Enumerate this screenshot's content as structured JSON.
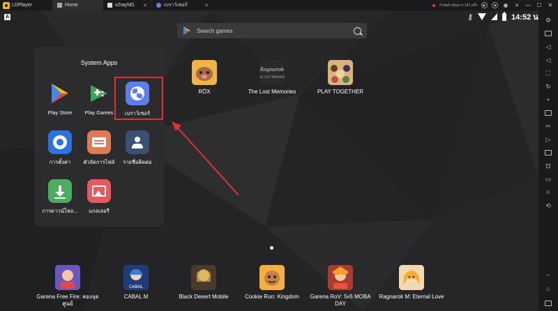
{
  "titlebar": {
    "app_name": "LDPlayer",
    "tabs": [
      {
        "label": "Home"
      },
      {
        "label": "v2rayNG"
      },
      {
        "label": "เบราว์เซอร์"
      }
    ],
    "status_text": "กำลังดำเนินการ 157 ครั้ง"
  },
  "statusbar": {
    "badge": "A",
    "time": "14:52 น."
  },
  "search": {
    "placeholder": "Search games"
  },
  "system_apps": {
    "title": "System Apps",
    "apps": [
      {
        "label": "Play Store",
        "icon": "play-store-icon"
      },
      {
        "label": "Play Games",
        "icon": "play-games-icon"
      },
      {
        "label": "เบราว์เซอร์",
        "icon": "browser-globe-icon"
      },
      {
        "label": "การตั้งค่า",
        "icon": "settings-gear-icon"
      },
      {
        "label": "ตัวจัดการไฟล์",
        "icon": "file-manager-icon"
      },
      {
        "label": "รายชื่อติดต่อ",
        "icon": "contacts-icon"
      },
      {
        "label": "การดาวน์โหล...",
        "icon": "downloads-icon"
      },
      {
        "label": "แกลเลอรี",
        "icon": "gallery-icon"
      }
    ]
  },
  "desktop_apps": [
    {
      "label": "RÖX",
      "icon": "rox-icon"
    },
    {
      "label": "The Lost Memories",
      "icon": "lost-memories-icon"
    },
    {
      "label": "PLAY TOGETHER",
      "icon": "play-together-icon"
    }
  ],
  "dock_apps": [
    {
      "label": "Garena Free Fire: สองจุด ศูนย์",
      "icon": "free-fire-icon"
    },
    {
      "label": "CABAL M",
      "icon": "cabal-m-icon"
    },
    {
      "label": "Black Desert Mobile",
      "icon": "black-desert-icon"
    },
    {
      "label": "Cookie Run: Kingdom",
      "icon": "cookie-run-icon"
    },
    {
      "label": "Garena RoV: 5v5 MOBA DAY",
      "icon": "rov-icon"
    },
    {
      "label": "Ragnarok M: Eternal Love",
      "icon": "ragnarok-m-icon"
    }
  ],
  "colors": {
    "accent_red": "#e03232",
    "panel_bg": "#2c2c2e",
    "wallpaper": "#232326"
  }
}
